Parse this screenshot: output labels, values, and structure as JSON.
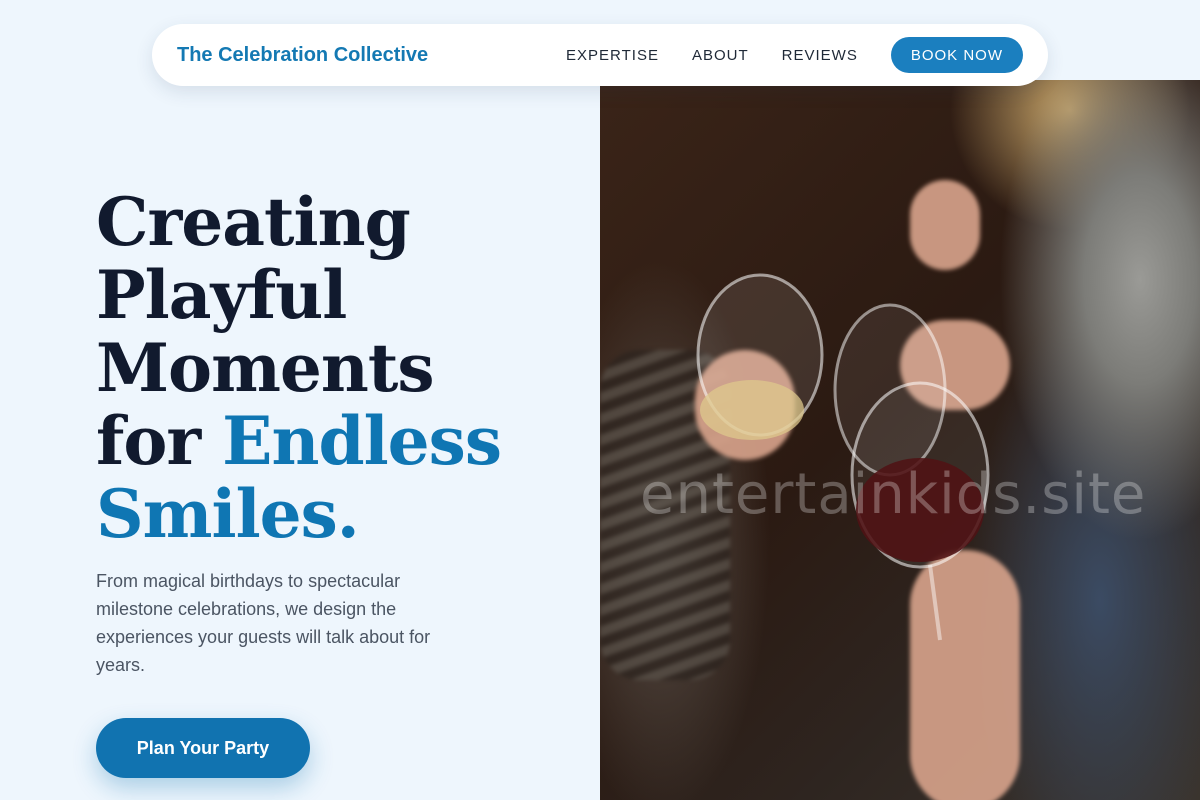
{
  "nav": {
    "brand": "The Celebration Collective",
    "links": [
      "EXPERTISE",
      "ABOUT",
      "REVIEWS"
    ],
    "book_label": "BOOK NOW"
  },
  "hero": {
    "headline_lines": [
      "Creating",
      "Playful",
      "Moments",
      "for "
    ],
    "headline_accent_1": "Endless",
    "headline_accent_2": "Smiles.",
    "subtext": "From magical birthdays to spectacular milestone celebrations, we design the experiences your guests will talk about for years.",
    "cta_label": "Plan Your Party"
  },
  "image": {
    "watermark": "entertainkids.site"
  },
  "colors": {
    "accent": "#0f76b3",
    "button": "#1b7fbf",
    "background": "#eef6fd",
    "headline": "#111a2e"
  }
}
